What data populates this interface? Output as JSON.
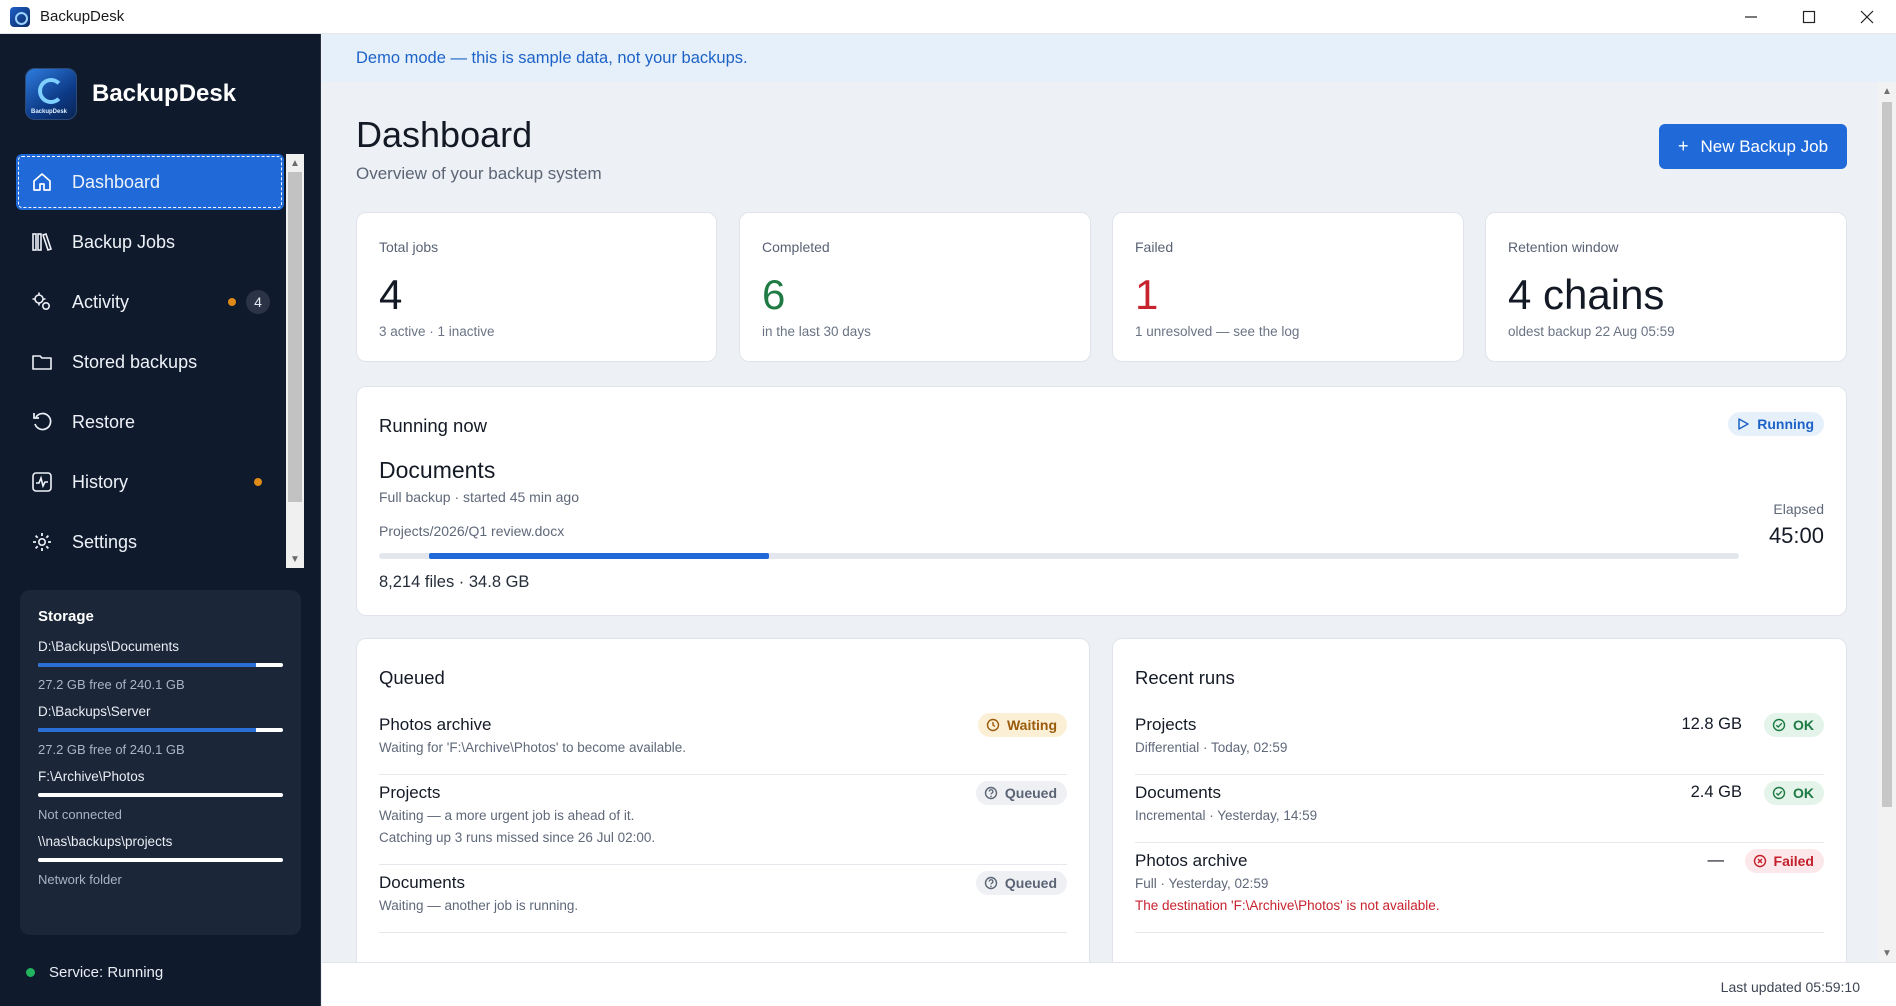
{
  "window": {
    "title": "BackupDesk"
  },
  "brand": {
    "name": "BackupDesk",
    "logo_text": "BackupDesk"
  },
  "nav": [
    {
      "label": "Dashboard",
      "icon": "home-icon",
      "active": true
    },
    {
      "label": "Backup Jobs",
      "icon": "books-icon"
    },
    {
      "label": "Activity",
      "icon": "gears-icon",
      "count": "4",
      "dot": true
    },
    {
      "label": "Stored backups",
      "icon": "folder-icon"
    },
    {
      "label": "Restore",
      "icon": "restore-icon"
    },
    {
      "label": "History",
      "icon": "pulse-icon",
      "dot": true
    },
    {
      "label": "Settings",
      "icon": "gear-icon"
    }
  ],
  "storage": {
    "title": "Storage",
    "drives": [
      {
        "path": "D:\\Backups\\Documents",
        "used": 0.89,
        "note": "27.2 GB free of 240.1 GB"
      },
      {
        "path": "D:\\Backups\\Server",
        "used": 0.89,
        "note": "27.2 GB free of 240.1 GB"
      },
      {
        "path": "F:\\Archive\\Photos",
        "used": 0,
        "note": "Not connected"
      },
      {
        "path": "\\\\nas\\backups\\projects",
        "used": 0,
        "note": "Network folder"
      }
    ]
  },
  "service": {
    "label": "Service: Running"
  },
  "banner": {
    "text": "Demo mode — this is sample data, not your backups."
  },
  "header": {
    "title": "Dashboard",
    "subtitle": "Overview of your backup system",
    "new_button": "New Backup Job",
    "new_button_plus": "+"
  },
  "stats": [
    {
      "label": "Total jobs",
      "value": "4",
      "note": "3 active · 1 inactive"
    },
    {
      "label": "Completed",
      "value": "6",
      "note": "in the last 30 days"
    },
    {
      "label": "Failed",
      "value": "1",
      "note": "1 unresolved — see the log"
    },
    {
      "label": "Retention window",
      "value": "4 chains",
      "note": "oldest backup 22 Aug 05:59"
    }
  ],
  "running": {
    "title": "Running now",
    "badge": "Running",
    "job": "Documents",
    "detail": "Full backup · started 45 min ago",
    "current_file": "Projects/2026/Q1 review.docx",
    "progress_start": 0.037,
    "progress_end": 0.287,
    "summary": "8,214 files · 34.8 GB",
    "elapsed_label": "Elapsed",
    "elapsed_value": "45:00"
  },
  "queued": {
    "title": "Queued",
    "items": [
      {
        "name": "Photos archive",
        "desc": "Waiting for 'F:\\Archive\\Photos' to become available.",
        "status": "Waiting"
      },
      {
        "name": "Projects",
        "desc": "Waiting — a more urgent job is ahead of it.",
        "desc2": "Catching up 3 runs missed since 26 Jul 02:00.",
        "status": "Queued"
      },
      {
        "name": "Documents",
        "desc": "Waiting — another job is running.",
        "status": "Queued"
      }
    ]
  },
  "recent": {
    "title": "Recent runs",
    "items": [
      {
        "name": "Projects",
        "desc": "Differential · Today, 02:59",
        "size": "12.8 GB",
        "status": "OK"
      },
      {
        "name": "Documents",
        "desc": "Incremental · Yesterday, 14:59",
        "size": "2.4 GB",
        "status": "OK"
      },
      {
        "name": "Photos archive",
        "desc": "Full · Yesterday, 02:59",
        "error": "The destination 'F:\\Archive\\Photos' is not available.",
        "size": "—",
        "status": "Failed"
      }
    ]
  },
  "footer": {
    "updated": "Last updated 05:59:10"
  },
  "colors": {
    "accent": "#1f6ad8",
    "sidebar": "#0f1a2d",
    "ok": "#1c7a42",
    "fail": "#c3202c",
    "warn": "#9a5b0a"
  }
}
